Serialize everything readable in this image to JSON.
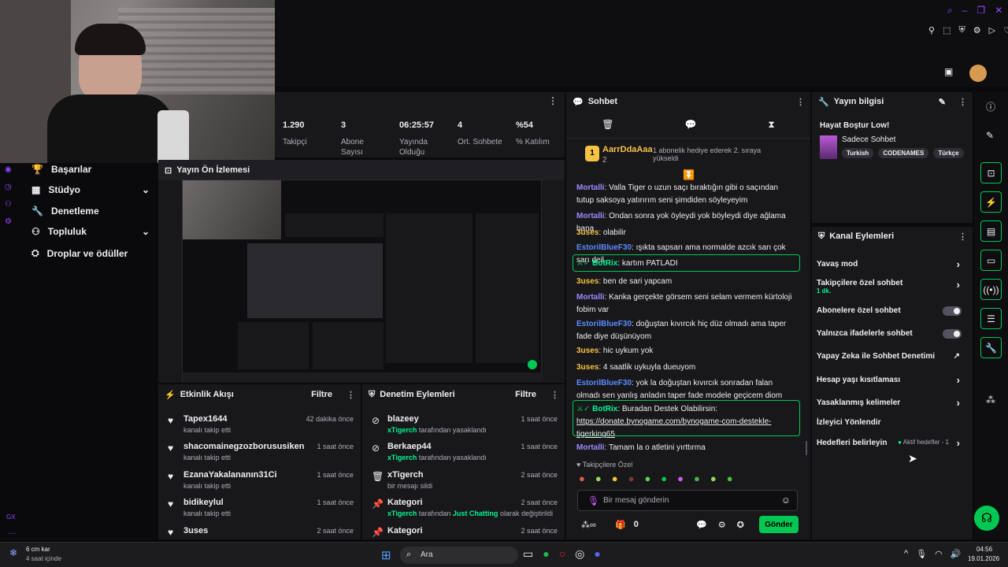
{
  "colors": {
    "accent": "#00c853",
    "twitch_purple": "#9147ff",
    "bg": "#0e0e10",
    "panel": "#18181b"
  },
  "stats": [
    {
      "value": "1.290",
      "label": "Takipçi"
    },
    {
      "value": "3",
      "label": "Abone Sayısı"
    },
    {
      "value": "06:25:57",
      "label": "Yayında Olduğu"
    },
    {
      "value": "4",
      "label": "Ort. Sohbete"
    },
    {
      "value": "%54",
      "label": "% Katılım"
    }
  ],
  "sidebar": {
    "items": [
      {
        "label": "Başarılar",
        "icon": "trophy-icon"
      },
      {
        "label": "Stüdyo",
        "icon": "video-icon"
      },
      {
        "label": "Denetleme",
        "icon": "wrench-icon"
      },
      {
        "label": "Topluluk",
        "icon": "people-icon"
      },
      {
        "label": "Droplar ve ödüller",
        "icon": "gift-icon"
      }
    ],
    "bottom_label": "GX"
  },
  "preview": {
    "title": "Yayın Ön İzlemesi"
  },
  "activity_feed": {
    "title": "Etkinlik Akışı",
    "filter": "Filtre",
    "rows": [
      {
        "name": "Tapex1644",
        "sub": "kanalı takip etti",
        "time": "42 dakika önce"
      },
      {
        "name": "shacomainegzozborususiken",
        "sub": "kanalı takip etti",
        "time": "1 saat önce"
      },
      {
        "name": "EzanaYakalananın31Ci",
        "sub": "kanalı takip etti",
        "time": "1 saat önce"
      },
      {
        "name": "bidikeylul",
        "sub": "kanalı takip etti",
        "time": "1 saat önce"
      },
      {
        "name": "3uses",
        "sub": "",
        "time": "2 saat önce"
      }
    ]
  },
  "mod_actions": {
    "title": "Denetim Eylemleri",
    "filter": "Filtre",
    "rows": [
      {
        "name": "blazeey",
        "actor": "xTigerch",
        "sub": "tarafından yasaklandı",
        "time": "1 saat önce",
        "icon": "ban-icon"
      },
      {
        "name": "Berkaep44",
        "actor": "xTigerch",
        "sub": "tarafından yasaklandı",
        "time": "1 saat önce",
        "icon": "ban-icon"
      },
      {
        "name": "xTigerch",
        "actor": "",
        "sub": "bir mesajı sildi",
        "time": "2 saat önce",
        "icon": "trash-icon"
      },
      {
        "name": "Kategori",
        "actor": "xTigerch",
        "sub": "tarafından",
        "extra": "Just Chatting",
        "tail": "olarak değiştirildi",
        "time": "2 saat önce",
        "icon": "pin-icon"
      },
      {
        "name": "Kategori",
        "actor": "",
        "sub": "",
        "time": "2 saat önce",
        "icon": "pin-icon"
      }
    ]
  },
  "chat": {
    "title": "Sohbet",
    "pinned_user": "AarrDdaAaa",
    "pinned_count": "2",
    "pinned_text": "1 abonelik hediye ederek 2. sıraya yükseldi",
    "messages": [
      {
        "user": "Mortalli",
        "text": "Valla Tiger o uzun saçı bıraktığın gibi o saçından tutup saksoya yatırırım seni şimdiden söyleyeyim",
        "color": "#9b8cff"
      },
      {
        "user": "Mortalli",
        "text": "Ondan sonra yok öyleydi yok böyleydi diye ağlama bana",
        "color": "#9b8cff"
      },
      {
        "user": "3uses",
        "text": "olabilir",
        "color": "#f5c242"
      },
      {
        "user": "EstorilBlueF30",
        "text": "ışıkta sapsarı ama normalde azcık sarı çok sarı deil",
        "color": "#5b8cff"
      },
      {
        "user": "BotRix",
        "text": "kartım PATLADI",
        "color": "#00f593",
        "bot": true
      },
      {
        "user": "3uses",
        "text": "ben de sari yapcam",
        "color": "#f5c242"
      },
      {
        "user": "Mortalli",
        "text": "Kanka gerçekte görsem seni selam vermem kürtoloji fobim var",
        "color": "#9b8cff"
      },
      {
        "user": "EstorilBlueF30",
        "text": "doğuştan kıvırcık hiç düz olmadı ama taper fade diye düşünüyom",
        "color": "#5b8cff"
      },
      {
        "user": "3uses",
        "text": "hic uykum yok",
        "color": "#f5c242"
      },
      {
        "user": "3uses",
        "text": "4 saatlik uykuyla dueuyom",
        "color": "#f5c242"
      },
      {
        "user": "EstorilBlueF30",
        "text": "yok la doğuştan kıvırcık sonradan falan olmadı sen yanlış anladın taper fade modele geçicem diom",
        "color": "#5b8cff"
      },
      {
        "user": "BotRix",
        "text": "Buradan Destek Olabilirsin:",
        "link": "https://donate.bynogame.com/bynogame-com-destekle-tigerking65",
        "color": "#00f593",
        "bot": true
      },
      {
        "user": "Mortalli",
        "text": "Tamam la o atletini yırttırma",
        "color": "#9b8cff"
      }
    ],
    "follower_only": "Takipçilere Özel",
    "input_placeholder": "Bir mesaj gönderin",
    "points": "0",
    "send": "Gönder"
  },
  "stream_info": {
    "title": "Yayın bilgisi",
    "stream_title": "Hayat Boştur Low!",
    "category": "Sadece Sohbet",
    "tags": [
      "Turkish",
      "CODENAMES",
      "Türkçe"
    ]
  },
  "channel_actions": {
    "title": "Kanal Eylemleri",
    "items": [
      {
        "label": "Yavaş mod",
        "type": "chevron"
      },
      {
        "label": "Takipçilere özel sohbet",
        "sub": "1 dk.",
        "type": "chevron"
      },
      {
        "label": "Abonelere özel sohbet",
        "type": "toggle"
      },
      {
        "label": "Yalnızca ifadelerle sohbet",
        "type": "toggle"
      },
      {
        "label": "Yapay Zeka ile Sohbet Denetimi",
        "type": "external"
      },
      {
        "label": "Hesap yaşı kısıtlaması",
        "type": "chevron"
      },
      {
        "label": "Yasaklanmış kelimeler",
        "type": "chevron"
      },
      {
        "label": "İzleyici Yönlendir",
        "type": "none"
      },
      {
        "label": "Hedefleri belirleyin",
        "type": "chevron",
        "status": "Aktif hedefler - 1"
      }
    ]
  },
  "taskbar": {
    "weather_temp": "6 cm kar",
    "weather_sub": "4 saat içinde",
    "search": "Ara",
    "time": "04:56",
    "date": "19.01.2026"
  }
}
